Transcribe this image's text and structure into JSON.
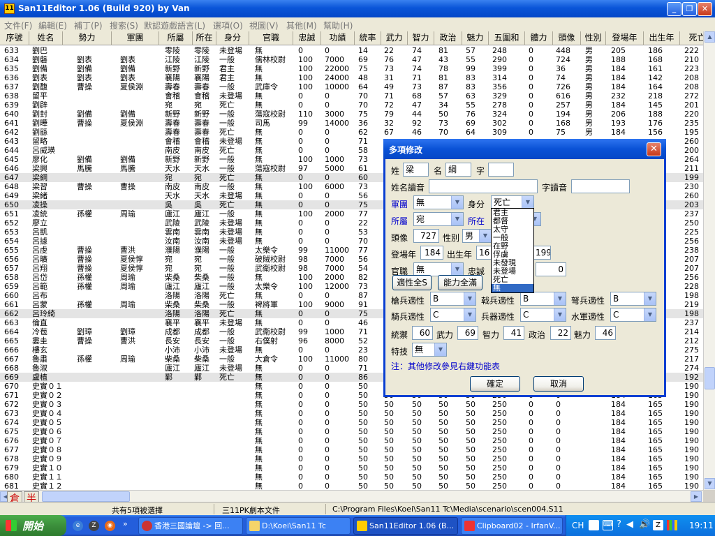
{
  "window": {
    "title": "San11Editor 1.06 (Build 920) by Van",
    "app_icon": "11"
  },
  "menu": [
    "文件(F)",
    "編輯(E)",
    "補丁(P)",
    "搜索(S)",
    "默認遊戲語言(L)",
    "選項(O)",
    "視圖(V)",
    "其他(M)",
    "幫助(H)"
  ],
  "columns": [
    "序號",
    "姓名",
    "勢力",
    "軍團",
    "所屬",
    "所在",
    "身分",
    "官職",
    "忠誠",
    "功績",
    "統率",
    "武力",
    "智力",
    "政治",
    "魅力",
    "五圍和",
    "體力",
    "頭像",
    "性別",
    "登場年",
    "出生年",
    "死亡"
  ],
  "rows": [
    [
      "633",
      "劉巴",
      "",
      "",
      "零陵",
      "零陵",
      "未登場",
      "無",
      "0",
      "0",
      "14",
      "22",
      "74",
      "81",
      "57",
      "248",
      "0",
      "448",
      "男",
      "205",
      "186",
      "222"
    ],
    [
      "634",
      "劉磐",
      "劉表",
      "劉表",
      "江陵",
      "江陵",
      "一般",
      "儒林校尉",
      "100",
      "7000",
      "69",
      "76",
      "47",
      "43",
      "55",
      "290",
      "0",
      "724",
      "男",
      "188",
      "168",
      "210"
    ],
    [
      "635",
      "劉備",
      "劉備",
      "劉備",
      "新野",
      "新野",
      "君主",
      "無",
      "100",
      "22000",
      "75",
      "73",
      "74",
      "78",
      "99",
      "399",
      "0",
      "36",
      "男",
      "184",
      "161",
      "223"
    ],
    [
      "636",
      "劉表",
      "劉表",
      "劉表",
      "襄陽",
      "襄陽",
      "君主",
      "無",
      "100",
      "24000",
      "48",
      "31",
      "71",
      "81",
      "83",
      "314",
      "0",
      "74",
      "男",
      "184",
      "142",
      "208"
    ],
    [
      "637",
      "劉馥",
      "曹操",
      "夏侯淵",
      "壽春",
      "壽春",
      "一般",
      "武庫令",
      "100",
      "10000",
      "64",
      "49",
      "73",
      "87",
      "83",
      "356",
      "0",
      "726",
      "男",
      "184",
      "164",
      "208"
    ],
    [
      "638",
      "留平",
      "",
      "",
      "會稽",
      "會稽",
      "未登場",
      "無",
      "0",
      "0",
      "70",
      "71",
      "68",
      "57",
      "63",
      "329",
      "0",
      "616",
      "男",
      "232",
      "218",
      "272"
    ],
    [
      "639",
      "劉辟",
      "",
      "",
      "宛",
      "宛",
      "死亡",
      "無",
      "0",
      "0",
      "70",
      "72",
      "47",
      "34",
      "55",
      "278",
      "0",
      "257",
      "男",
      "184",
      "145",
      "201"
    ],
    [
      "640",
      "劉封",
      "劉備",
      "劉備",
      "新野",
      "新野",
      "一般",
      "蕩寇校尉",
      "110",
      "3000",
      "75",
      "79",
      "44",
      "50",
      "76",
      "324",
      "0",
      "194",
      "男",
      "206",
      "188",
      "220"
    ],
    [
      "641",
      "劉曄",
      "曹操",
      "夏侯淵",
      "壽春",
      "壽春",
      "一般",
      "司馬",
      "99",
      "14000",
      "36",
      "32",
      "92",
      "73",
      "69",
      "302",
      "0",
      "168",
      "男",
      "193",
      "176",
      "235"
    ],
    [
      "642",
      "劉繇",
      "",
      "",
      "壽春",
      "壽春",
      "死亡",
      "無",
      "0",
      "0",
      "62",
      "67",
      "46",
      "70",
      "64",
      "309",
      "0",
      "75",
      "男",
      "184",
      "156",
      "195"
    ],
    [
      "643",
      "留略",
      "",
      "",
      "會稽",
      "會稽",
      "未登場",
      "無",
      "0",
      "0",
      "71",
      "",
      "",
      "",
      "",
      "",
      "",
      "",
      "",
      "",
      "",
      "260"
    ],
    [
      "644",
      "呂威璜",
      "",
      "",
      "南皮",
      "南皮",
      "死亡",
      "無",
      "0",
      "0",
      "58",
      "",
      "",
      "",
      "",
      "",
      "",
      "",
      "",
      "",
      "",
      "200"
    ],
    [
      "645",
      "廖化",
      "劉備",
      "劉備",
      "新野",
      "新野",
      "一般",
      "無",
      "100",
      "1000",
      "73",
      "",
      "",
      "",
      "",
      "",
      "",
      "",
      "",
      "",
      "",
      "264"
    ],
    [
      "646",
      "梁興",
      "馬騰",
      "馬騰",
      "天水",
      "天水",
      "一般",
      "蕩寇校尉",
      "97",
      "5000",
      "61",
      "",
      "",
      "",
      "",
      "",
      "",
      "",
      "",
      "",
      "",
      "211"
    ],
    [
      "647",
      "梁綱",
      "",
      "",
      "宛",
      "宛",
      "死亡",
      "無",
      "0",
      "0",
      "60",
      "",
      "",
      "",
      "",
      "",
      "",
      "",
      "",
      "",
      "",
      "199"
    ],
    [
      "648",
      "梁習",
      "曹操",
      "曹操",
      "南皮",
      "南皮",
      "一般",
      "無",
      "100",
      "6000",
      "73",
      "",
      "",
      "",
      "",
      "",
      "",
      "",
      "",
      "",
      "",
      "230"
    ],
    [
      "649",
      "梁緒",
      "",
      "",
      "天水",
      "天水",
      "未登場",
      "無",
      "0",
      "0",
      "56",
      "",
      "",
      "",
      "",
      "",
      "",
      "",
      "",
      "",
      "",
      "260"
    ],
    [
      "650",
      "凌操",
      "",
      "",
      "吳",
      "吳",
      "死亡",
      "無",
      "0",
      "0",
      "75",
      "",
      "",
      "",
      "",
      "",
      "",
      "",
      "",
      "",
      "",
      "203"
    ],
    [
      "651",
      "凌統",
      "孫權",
      "周瑜",
      "廬江",
      "廬江",
      "一般",
      "無",
      "100",
      "2000",
      "77",
      "",
      "",
      "",
      "",
      "",
      "",
      "",
      "",
      "",
      "",
      "237"
    ],
    [
      "652",
      "廖立",
      "",
      "",
      "武陵",
      "武陵",
      "未登場",
      "無",
      "0",
      "0",
      "22",
      "",
      "",
      "",
      "",
      "",
      "",
      "",
      "",
      "",
      "",
      "250"
    ],
    [
      "653",
      "呂凱",
      "",
      "",
      "雲南",
      "雲南",
      "未登場",
      "無",
      "0",
      "0",
      "53",
      "",
      "",
      "",
      "",
      "",
      "",
      "",
      "",
      "",
      "",
      "225"
    ],
    [
      "654",
      "呂據",
      "",
      "",
      "汝南",
      "汝南",
      "未登場",
      "無",
      "0",
      "0",
      "70",
      "",
      "",
      "",
      "",
      "",
      "",
      "",
      "",
      "",
      "",
      "256"
    ],
    [
      "655",
      "呂虔",
      "曹操",
      "曹洪",
      "濮陽",
      "濮陽",
      "一般",
      "太樂令",
      "99",
      "11000",
      "77",
      "",
      "",
      "",
      "",
      "",
      "",
      "",
      "",
      "",
      "",
      "238"
    ],
    [
      "656",
      "呂曠",
      "曹操",
      "夏侯惇",
      "宛",
      "宛",
      "一般",
      "破賊校尉",
      "98",
      "7000",
      "56",
      "",
      "",
      "",
      "",
      "",
      "",
      "",
      "",
      "",
      "",
      "207"
    ],
    [
      "657",
      "呂翔",
      "曹操",
      "夏侯惇",
      "宛",
      "宛",
      "一般",
      "武衛校尉",
      "98",
      "7000",
      "54",
      "",
      "",
      "",
      "",
      "",
      "",
      "",
      "",
      "",
      "",
      "207"
    ],
    [
      "658",
      "呂岱",
      "孫權",
      "周瑜",
      "柴桑",
      "柴桑",
      "一般",
      "無",
      "100",
      "2000",
      "82",
      "",
      "",
      "",
      "",
      "",
      "",
      "",
      "",
      "",
      "",
      "256"
    ],
    [
      "659",
      "呂範",
      "孫權",
      "周瑜",
      "廬江",
      "廬江",
      "一般",
      "太樂令",
      "100",
      "12000",
      "73",
      "",
      "",
      "",
      "",
      "",
      "",
      "",
      "",
      "",
      "",
      "228"
    ],
    [
      "660",
      "呂布",
      "",
      "",
      "洛陽",
      "洛陽",
      "死亡",
      "無",
      "0",
      "0",
      "87",
      "",
      "",
      "",
      "",
      "",
      "",
      "",
      "",
      "",
      "",
      "198"
    ],
    [
      "661",
      "呂蒙",
      "孫權",
      "周瑜",
      "柴桑",
      "柴桑",
      "一般",
      "裨將軍",
      "100",
      "9000",
      "91",
      "",
      "",
      "",
      "",
      "",
      "",
      "",
      "",
      "",
      "",
      "219"
    ],
    [
      "662",
      "呂玲綺",
      "",
      "",
      "洛陽",
      "洛陽",
      "死亡",
      "無",
      "0",
      "0",
      "75",
      "",
      "",
      "",
      "",
      "",
      "",
      "",
      "",
      "",
      "",
      "198"
    ],
    [
      "663",
      "倫直",
      "",
      "",
      "襄平",
      "襄平",
      "未登場",
      "無",
      "0",
      "0",
      "46",
      "",
      "",
      "",
      "",
      "",
      "",
      "",
      "",
      "",
      "",
      "237"
    ],
    [
      "664",
      "冷苞",
      "劉璋",
      "劉璋",
      "成都",
      "成都",
      "一般",
      "武衛校尉",
      "99",
      "1000",
      "71",
      "",
      "",
      "",
      "",
      "",
      "",
      "",
      "",
      "",
      "",
      "214"
    ],
    [
      "665",
      "婁圭",
      "曹操",
      "曹洪",
      "長安",
      "長安",
      "一般",
      "右僕射",
      "96",
      "8000",
      "52",
      "",
      "",
      "",
      "",
      "",
      "",
      "",
      "",
      "",
      "",
      "212"
    ],
    [
      "666",
      "樓玄",
      "",
      "",
      "小沛",
      "小沛",
      "未登場",
      "無",
      "0",
      "0",
      "23",
      "",
      "",
      "",
      "",
      "",
      "",
      "",
      "",
      "",
      "",
      "275"
    ],
    [
      "667",
      "魯肅",
      "孫權",
      "周瑜",
      "柴桑",
      "柴桑",
      "一般",
      "大倉令",
      "100",
      "11000",
      "80",
      "",
      "",
      "",
      "",
      "",
      "",
      "",
      "",
      "",
      "",
      "217"
    ],
    [
      "668",
      "魯淑",
      "",
      "",
      "廬江",
      "廬江",
      "未登場",
      "無",
      "0",
      "0",
      "71",
      "",
      "",
      "",
      "",
      "",
      "",
      "",
      "",
      "",
      "",
      "274"
    ],
    [
      "669",
      "盧植",
      "",
      "",
      "鄴",
      "鄴",
      "死亡",
      "無",
      "0",
      "0",
      "86",
      "",
      "",
      "",
      "",
      "",
      "",
      "",
      "",
      "",
      "",
      "192"
    ],
    [
      "670",
      "史實０１",
      "",
      "",
      "",
      "",
      "",
      "無",
      "0",
      "0",
      "50",
      "50",
      "50",
      "50",
      "50",
      "250",
      "0",
      "0",
      "",
      "184",
      "165",
      "190"
    ],
    [
      "671",
      "史實０２",
      "",
      "",
      "",
      "",
      "",
      "無",
      "0",
      "0",
      "50",
      "50",
      "50",
      "50",
      "50",
      "250",
      "0",
      "0",
      "",
      "184",
      "165",
      "190"
    ],
    [
      "672",
      "史實０３",
      "",
      "",
      "",
      "",
      "",
      "無",
      "0",
      "0",
      "50",
      "50",
      "50",
      "50",
      "50",
      "250",
      "0",
      "0",
      "",
      "184",
      "165",
      "190"
    ],
    [
      "673",
      "史實０４",
      "",
      "",
      "",
      "",
      "",
      "無",
      "0",
      "0",
      "50",
      "50",
      "50",
      "50",
      "50",
      "250",
      "0",
      "0",
      "",
      "184",
      "165",
      "190"
    ],
    [
      "674",
      "史實０５",
      "",
      "",
      "",
      "",
      "",
      "無",
      "0",
      "0",
      "50",
      "50",
      "50",
      "50",
      "50",
      "250",
      "0",
      "0",
      "",
      "184",
      "165",
      "190"
    ],
    [
      "675",
      "史實０６",
      "",
      "",
      "",
      "",
      "",
      "無",
      "0",
      "0",
      "50",
      "50",
      "50",
      "50",
      "50",
      "250",
      "0",
      "0",
      "",
      "184",
      "165",
      "190"
    ],
    [
      "676",
      "史實０７",
      "",
      "",
      "",
      "",
      "",
      "無",
      "0",
      "0",
      "50",
      "50",
      "50",
      "50",
      "50",
      "250",
      "0",
      "0",
      "",
      "184",
      "165",
      "190"
    ],
    [
      "677",
      "史實０８",
      "",
      "",
      "",
      "",
      "",
      "無",
      "0",
      "0",
      "50",
      "50",
      "50",
      "50",
      "50",
      "250",
      "0",
      "0",
      "",
      "184",
      "165",
      "190"
    ],
    [
      "678",
      "史實０９",
      "",
      "",
      "",
      "",
      "",
      "無",
      "0",
      "0",
      "50",
      "50",
      "50",
      "50",
      "50",
      "250",
      "0",
      "0",
      "",
      "184",
      "165",
      "190"
    ],
    [
      "679",
      "史實１０",
      "",
      "",
      "",
      "",
      "",
      "無",
      "0",
      "0",
      "50",
      "50",
      "50",
      "50",
      "50",
      "250",
      "0",
      "0",
      "",
      "184",
      "165",
      "190"
    ],
    [
      "680",
      "史實１１",
      "",
      "",
      "",
      "",
      "",
      "無",
      "0",
      "0",
      "50",
      "50",
      "50",
      "50",
      "50",
      "250",
      "0",
      "0",
      "",
      "184",
      "165",
      "190"
    ],
    [
      "681",
      "史實１２",
      "",
      "",
      "",
      "",
      "",
      "無",
      "0",
      "0",
      "50",
      "50",
      "50",
      "50",
      "50",
      "250",
      "0",
      "0",
      "",
      "184",
      "165",
      "190"
    ]
  ],
  "selected_rows": [
    "647",
    "650",
    "662",
    "669"
  ],
  "corner_buttons": [
    "倉",
    "半"
  ],
  "status": {
    "selection": "共有5項被選擇",
    "filetype": "三11PK劇本文件",
    "path": "C:\\Program Files\\Koei\\San11 Tc\\Media\\scenario\\scen004.S11"
  },
  "taskbar": {
    "start": "開始",
    "tasks": [
      "香港三國論壇 -> 回...",
      "D:\\Koei\\San11 Tc",
      "San11Editor 1.06 (B...",
      "Clipboard02 - IrfanV..."
    ],
    "lang": "CH",
    "clock": "19:11"
  },
  "dialog": {
    "title": "多項修改",
    "surname_label": "姓",
    "surname": "梁",
    "given_label": "名",
    "given": "綱",
    "style_label": "字",
    "style": "",
    "reading_label": "姓名讀音",
    "reading": "",
    "style_reading_label": "字讀音",
    "style_reading": "",
    "army_label": "軍團",
    "army": "無",
    "status_label": "身分",
    "status": "死亡",
    "belong_label": "所屬",
    "belong": "宛",
    "location_label": "所在",
    "portrait_label": "頭像",
    "portrait": "727",
    "gender_label": "性別",
    "gender": "男",
    "appear_label": "登場年",
    "appear": "184",
    "birth_label": "出生年",
    "birth": "16",
    "death": "199",
    "office_label": "官職",
    "office": "無",
    "loyalty_label": "忠誠",
    "loyalty": "0",
    "apt_all_s": "適性全S",
    "ability_full": "能力全滿",
    "spear_label": "槍兵適性",
    "spear": "B",
    "halberd_label": "戟兵適性",
    "halberd": "B",
    "bow_label": "弩兵適性",
    "bow": "B",
    "cavalry_label": "騎兵適性",
    "cavalry": "C",
    "weapon_label": "兵器適性",
    "weapon": "C",
    "navy_label": "水軍適性",
    "navy": "C",
    "lead_label": "統禦",
    "lead": "60",
    "war_label": "武力",
    "war": "69",
    "int_label": "智力",
    "int": "41",
    "pol_label": "政治",
    "pol": "22",
    "chr_label": "魅力",
    "chr": "46",
    "skill_label": "特技",
    "skill": "無",
    "note": "注：其他修改參見右鍵功能表",
    "ok": "確定",
    "cancel": "取消",
    "status_options": [
      "君主",
      "都督",
      "太守",
      "一般",
      "在野",
      "俘虜",
      "未發現",
      "未登場",
      "死亡",
      "無"
    ],
    "status_options_highlight": 9
  }
}
